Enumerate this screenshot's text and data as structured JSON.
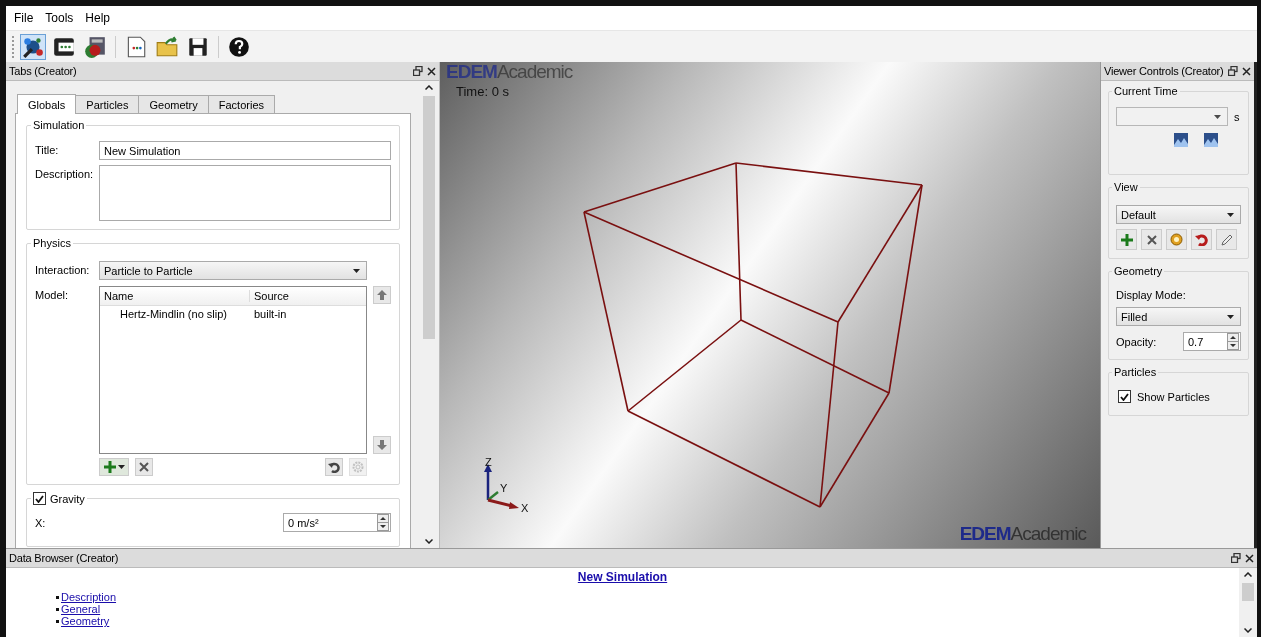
{
  "menu": [
    "File",
    "Tools",
    "Help"
  ],
  "creator": {
    "title": "Tabs (Creator)",
    "tabs": [
      {
        "label": "Globals",
        "selected": true
      },
      {
        "label": "Particles",
        "selected": false
      },
      {
        "label": "Geometry",
        "selected": false
      },
      {
        "label": "Factories",
        "selected": false
      }
    ],
    "simulation": {
      "legend": "Simulation",
      "title_label": "Title:",
      "title_value": "New Simulation",
      "description_label": "Description:"
    },
    "physics": {
      "legend": "Physics",
      "interaction_label": "Interaction:",
      "interaction_value": "Particle to Particle",
      "model_label": "Model:",
      "columns": [
        "Name",
        "Source"
      ],
      "rows": [
        [
          "Hertz-Mindlin (no slip)",
          "built-in"
        ]
      ]
    },
    "gravity": {
      "legend": "Gravity",
      "checked": true,
      "x_label": "X:",
      "x_value": "0 m/s²"
    }
  },
  "viewer": {
    "time": "Time: 0 s",
    "axes": [
      "Z",
      "Y",
      "X"
    ],
    "logo_top": {
      "brand": "EDEM",
      "suffix": "Academic"
    },
    "logo_bottom": {
      "brand": "EDEM",
      "suffix": "Academic"
    }
  },
  "controls": {
    "title": "Viewer Controls (Creator)",
    "current_time": {
      "legend": "Current Time",
      "unit": "s"
    },
    "view": {
      "legend": "View",
      "value": "Default"
    },
    "geometry": {
      "legend": "Geometry",
      "display_mode_label": "Display Mode:",
      "display_mode_value": "Filled",
      "opacity_label": "Opacity:",
      "opacity_value": "0.7"
    },
    "particles": {
      "legend": "Particles",
      "show_label": "Show Particles",
      "checked": true
    }
  },
  "data_browser": {
    "title": "Data Browser (Creator)",
    "heading": "New Simulation",
    "links": [
      "Description",
      "General",
      "Geometry"
    ]
  }
}
